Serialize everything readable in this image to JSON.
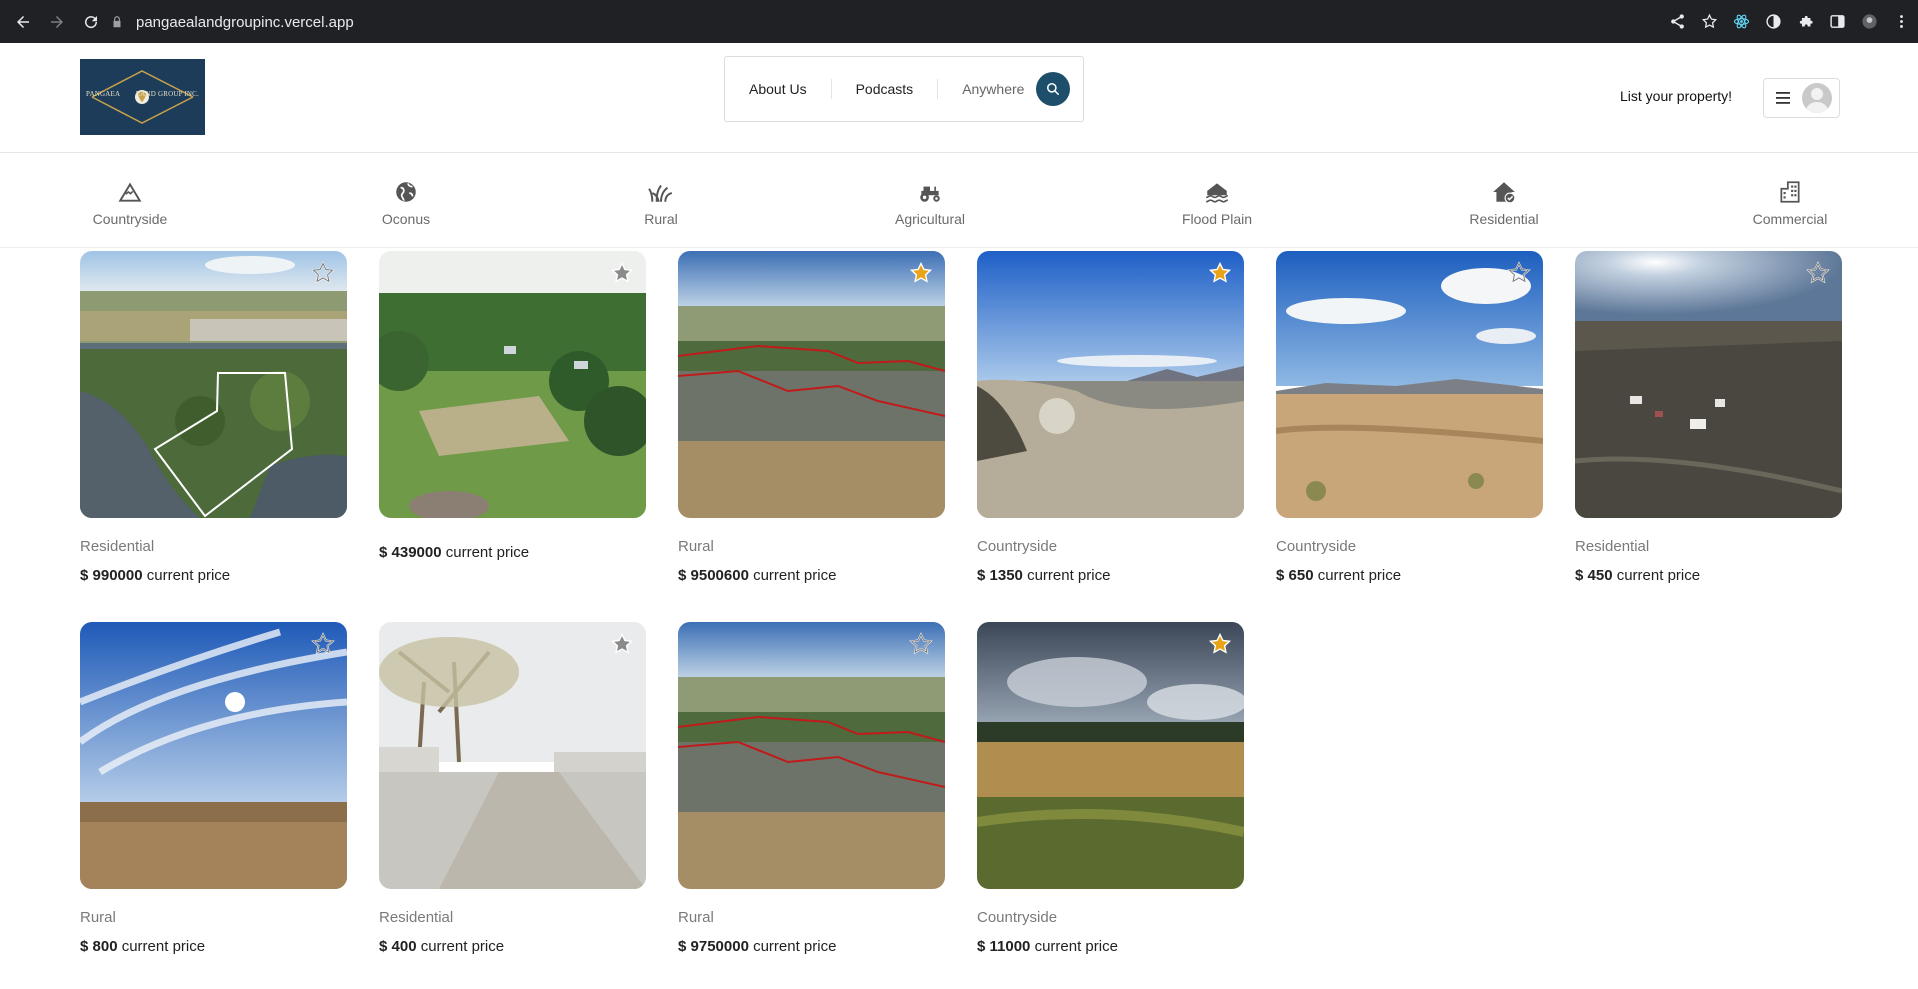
{
  "browser": {
    "url": "pangaealandgroupinc.vercel.app"
  },
  "logo": {
    "left_text": "PANGAEA",
    "right_text": "LAND GROUP INC."
  },
  "nav": {
    "about": "About Us",
    "podcasts": "Podcasts",
    "anywhere": "Anywhere"
  },
  "header": {
    "list_property": "List your property!"
  },
  "categories": [
    {
      "label": "Countryside",
      "icon": "mountain-icon"
    },
    {
      "label": "Oconus",
      "icon": "globe-icon"
    },
    {
      "label": "Rural",
      "icon": "grass-icon"
    },
    {
      "label": "Agricultural",
      "icon": "tractor-icon"
    },
    {
      "label": "Flood Plain",
      "icon": "flood-house-icon"
    },
    {
      "label": "Residential",
      "icon": "house-check-icon"
    },
    {
      "label": "Commercial",
      "icon": "building-icon"
    }
  ],
  "price_suffix": "current price",
  "listings": [
    {
      "category": "Residential",
      "price": "$ 990000",
      "favorited": false,
      "image": "aerial-lake-parcel"
    },
    {
      "category": "",
      "price": "$ 439000",
      "favorited": false,
      "image": "aerial-green-field"
    },
    {
      "category": "Rural",
      "price": "$ 9500600",
      "favorited": true,
      "image": "aerial-farmland-parcel"
    },
    {
      "category": "Countryside",
      "price": "$ 1350",
      "favorited": true,
      "image": "desert-shrubs-sky"
    },
    {
      "category": "Countryside",
      "price": "$ 650",
      "favorited": false,
      "image": "desert-plain-clouds"
    },
    {
      "category": "Residential",
      "price": "$ 450",
      "favorited": false,
      "image": "aerial-ranch-sunset"
    },
    {
      "category": "Rural",
      "price": "$ 800",
      "favorited": false,
      "image": "sun-sky-grassland"
    },
    {
      "category": "Residential",
      "price": "$ 400",
      "favorited": false,
      "image": "street-view-trees"
    },
    {
      "category": "Rural",
      "price": "$ 9750000",
      "favorited": false,
      "image": "aerial-farmland-parcel"
    },
    {
      "category": "Countryside",
      "price": "$ 11000",
      "favorited": true,
      "image": "meadow-storm-clouds"
    }
  ],
  "colors": {
    "star_active": "#e8a317",
    "star_inactive": "#888888",
    "search_button": "#1d4f6a"
  }
}
